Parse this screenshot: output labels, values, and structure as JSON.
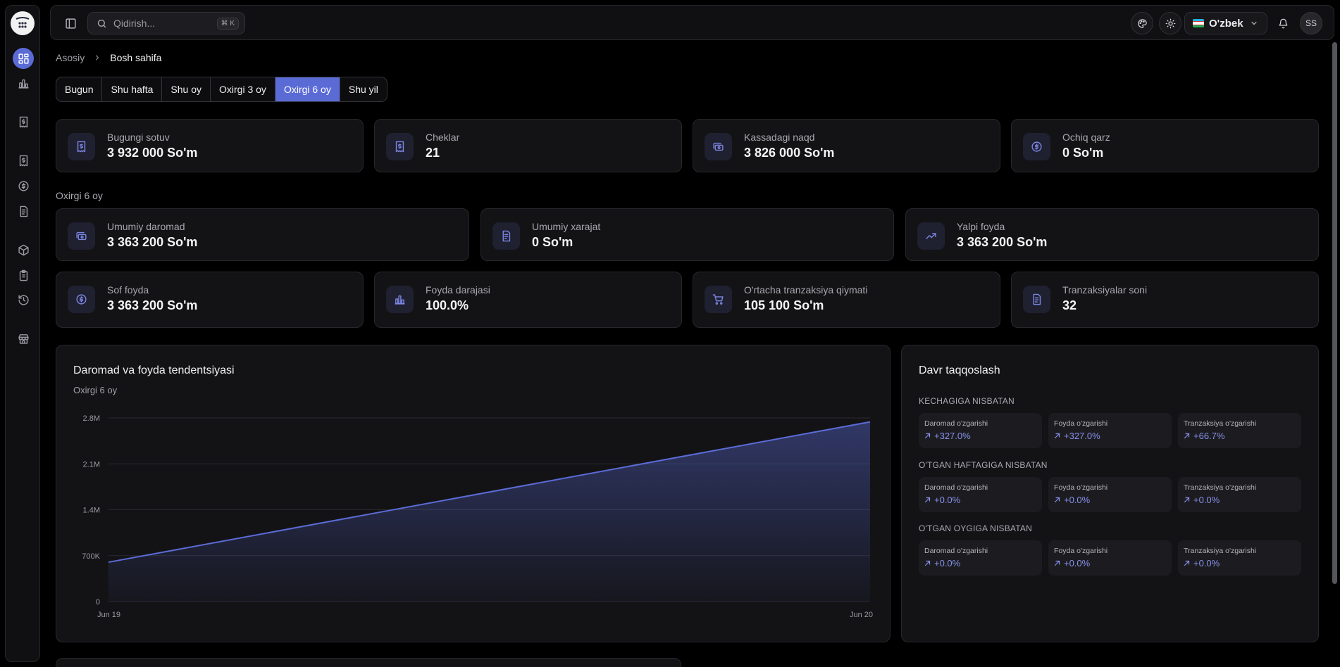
{
  "topbar": {
    "search_placeholder": "Qidirish...",
    "search_shortcut": "⌘ K",
    "language": "O'zbek",
    "avatar_initials": "SS"
  },
  "breadcrumb": {
    "root": "Asosiy",
    "current": "Bosh sahifa"
  },
  "periods": [
    {
      "label": "Bugun",
      "active": false
    },
    {
      "label": "Shu hafta",
      "active": false
    },
    {
      "label": "Shu oy",
      "active": false
    },
    {
      "label": "Oxirgi 3 oy",
      "active": false
    },
    {
      "label": "Oxirgi 6 oy",
      "active": true
    },
    {
      "label": "Shu yil",
      "active": false
    }
  ],
  "today_stats": [
    {
      "label": "Bugungi sotuv",
      "value": "3 932 000 So'm",
      "icon": "receipt-icon"
    },
    {
      "label": "Cheklar",
      "value": "21",
      "icon": "receipt-icon"
    },
    {
      "label": "Kassadagi naqd",
      "value": "3 826 000 So'm",
      "icon": "banknote-icon"
    },
    {
      "label": "Ochiq qarz",
      "value": "0 So'm",
      "icon": "dollar-circle-icon"
    }
  ],
  "period_label": "Oxirgi 6 oy",
  "period_stats_row1": [
    {
      "label": "Umumiy daromad",
      "value": "3 363 200 So'm",
      "icon": "banknote-icon"
    },
    {
      "label": "Umumiy xarajat",
      "value": "0 So'm",
      "icon": "document-icon"
    },
    {
      "label": "Yalpi foyda",
      "value": "3 363 200 So'm",
      "icon": "trending-up-icon"
    }
  ],
  "period_stats_row2": [
    {
      "label": "Sof foyda",
      "value": "3 363 200 So'm",
      "icon": "dollar-circle-icon"
    },
    {
      "label": "Foyda darajasi",
      "value": "100.0%",
      "icon": "bar-chart-icon"
    },
    {
      "label": "O'rtacha tranzaksiya qiymati",
      "value": "105 100 So'm",
      "icon": "cart-icon"
    },
    {
      "label": "Tranzaksiyalar soni",
      "value": "32",
      "icon": "document-icon"
    }
  ],
  "trend": {
    "title": "Daromad va foyda tendentsiyasi",
    "subtitle": "Oxirgi 6 oy"
  },
  "chart_data": {
    "type": "area",
    "categories": [
      "Jun 19",
      "Jun 20"
    ],
    "series": [
      {
        "values": [
          600000,
          2740000
        ],
        "color": "#5b6bd6"
      }
    ],
    "ylim": [
      0,
      2800000
    ],
    "yticks": [
      0,
      700000,
      1400000,
      2100000,
      2800000
    ],
    "ytick_labels": [
      "0",
      "700K",
      "1.4M",
      "2.1M",
      "2.8M"
    ],
    "grid": true
  },
  "comparison": {
    "title": "Davr taqqoslash",
    "groups": [
      {
        "title": "KECHAGIGA NISBATAN",
        "items": [
          {
            "label": "Daromad o'zgarishi",
            "value": "+327.0%"
          },
          {
            "label": "Foyda o'zgarishi",
            "value": "+327.0%"
          },
          {
            "label": "Tranzaksiya o'zgarishi",
            "value": "+66.7%"
          }
        ]
      },
      {
        "title": "O'TGAN HAFTAGIGA NISBATAN",
        "items": [
          {
            "label": "Daromad o'zgarishi",
            "value": "+0.0%"
          },
          {
            "label": "Foyda o'zgarishi",
            "value": "+0.0%"
          },
          {
            "label": "Tranzaksiya o'zgarishi",
            "value": "+0.0%"
          }
        ]
      },
      {
        "title": "O'TGAN OYGIGA NISBATAN",
        "items": [
          {
            "label": "Daromad o'zgarishi",
            "value": "+0.0%"
          },
          {
            "label": "Foyda o'zgarishi",
            "value": "+0.0%"
          },
          {
            "label": "Tranzaksiya o'zgarishi",
            "value": "+0.0%"
          }
        ]
      }
    ]
  },
  "colors": {
    "accent": "#5b6bd6",
    "positive": "#8790ea",
    "background": "#000000",
    "card": "#131316"
  }
}
